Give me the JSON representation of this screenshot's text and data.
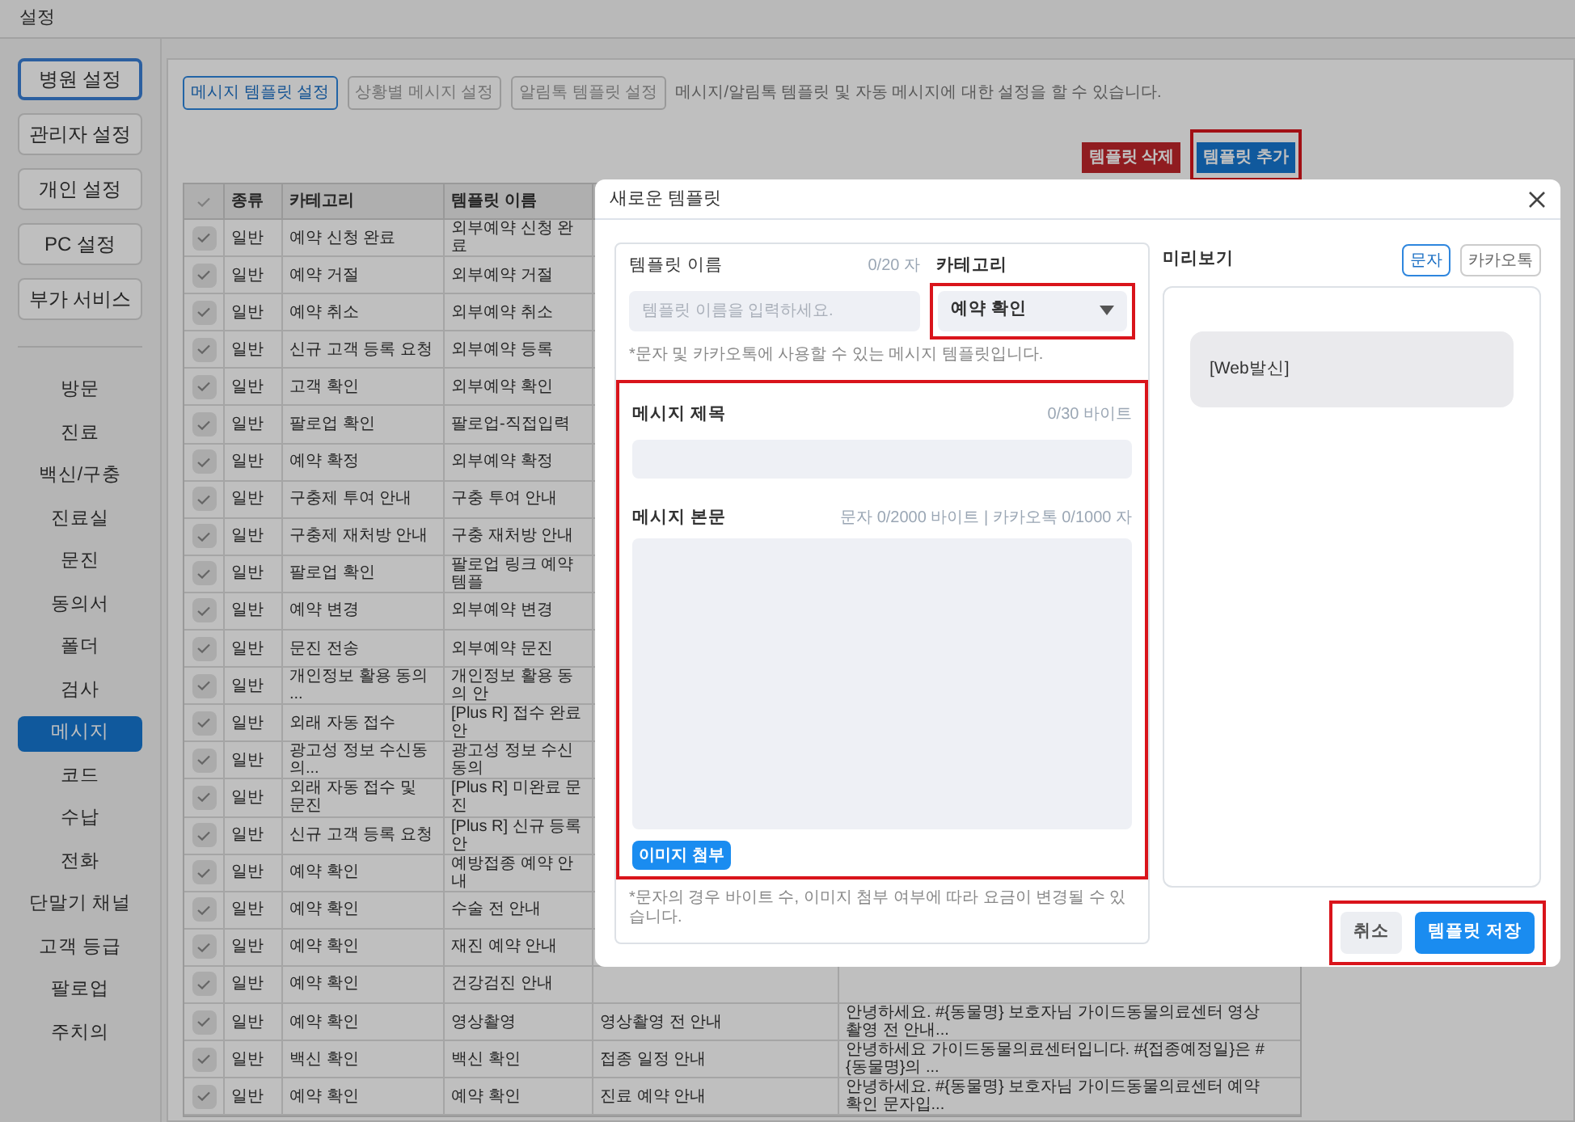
{
  "window": {
    "title": "설정"
  },
  "settings_menu": [
    {
      "label": "병원 설정",
      "selected": true
    },
    {
      "label": "관리자 설정",
      "selected": false
    },
    {
      "label": "개인 설정",
      "selected": false
    },
    {
      "label": "PC 설정",
      "selected": false
    },
    {
      "label": "부가 서비스",
      "selected": false
    }
  ],
  "nav": [
    {
      "label": "방문",
      "selected": false
    },
    {
      "label": "진료",
      "selected": false
    },
    {
      "label": "백신/구충",
      "selected": false
    },
    {
      "label": "진료실",
      "selected": false
    },
    {
      "label": "문진",
      "selected": false
    },
    {
      "label": "동의서",
      "selected": false
    },
    {
      "label": "폴더",
      "selected": false
    },
    {
      "label": "검사",
      "selected": false
    },
    {
      "label": "메시지",
      "selected": true
    },
    {
      "label": "코드",
      "selected": false
    },
    {
      "label": "수납",
      "selected": false
    },
    {
      "label": "전화",
      "selected": false
    },
    {
      "label": "단말기 채널",
      "selected": false
    },
    {
      "label": "고객 등급",
      "selected": false
    },
    {
      "label": "팔로업",
      "selected": false
    },
    {
      "label": "주치의",
      "selected": false
    }
  ],
  "tabs": [
    {
      "label": "메시지 템플릿 설정",
      "selected": true
    },
    {
      "label": "상황별 메시지 설정",
      "selected": false
    },
    {
      "label": "알림톡 템플릿 설정",
      "selected": false
    }
  ],
  "description": "메시지/알림톡 템플릿 및 자동 메시지에 대한 설정을 할 수 있습니다.",
  "actions": [
    {
      "label": "템플릿 삭제",
      "kind": "danger",
      "highlighted": false
    },
    {
      "label": "템플릿 추가",
      "kind": "primary",
      "highlighted": true
    }
  ],
  "table": {
    "columns": [
      "종류",
      "카테고리",
      "템플릿 이름"
    ],
    "rows": [
      {
        "checked": true,
        "type": "일반",
        "category": "예약 신청 완료",
        "name": "외부예약 신청 완료"
      },
      {
        "checked": true,
        "type": "일반",
        "category": "예약 거절",
        "name": "외부예약 거절"
      },
      {
        "checked": true,
        "type": "일반",
        "category": "예약 취소",
        "name": "외부예약 취소"
      },
      {
        "checked": true,
        "type": "일반",
        "category": "신규 고객 등록 요청",
        "name": "외부예약 등록"
      },
      {
        "checked": true,
        "type": "일반",
        "category": "고객 확인",
        "name": "외부예약 확인"
      },
      {
        "checked": true,
        "type": "일반",
        "category": "팔로업 확인",
        "name": "팔로업-직접입력"
      },
      {
        "checked": true,
        "type": "일반",
        "category": "예약 확정",
        "name": "외부예약 확정"
      },
      {
        "checked": true,
        "type": "일반",
        "category": "구충제 투여 안내",
        "name": "구충 투여 안내"
      },
      {
        "checked": true,
        "type": "일반",
        "category": "구충제 재처방 안내",
        "name": "구충 재처방 안내"
      },
      {
        "checked": true,
        "type": "일반",
        "category": "팔로업 확인",
        "name": "팔로업 링크 예약 템플"
      },
      {
        "checked": true,
        "type": "일반",
        "category": "예약 변경",
        "name": "외부예약 변경"
      },
      {
        "checked": true,
        "type": "일반",
        "category": "문진 전송",
        "name": "외부예약 문진"
      },
      {
        "checked": true,
        "type": "일반",
        "category": "개인정보 활용 동의 ...",
        "name": "개인정보 활용 동의 안"
      },
      {
        "checked": true,
        "type": "일반",
        "category": "외래 자동 접수",
        "name": "[Plus R] 접수 완료 안"
      },
      {
        "checked": true,
        "type": "일반",
        "category": "광고성 정보 수신동의...",
        "name": "광고성 정보 수신동의"
      },
      {
        "checked": true,
        "type": "일반",
        "category": "외래 자동 접수 및 문진",
        "name": "[Plus R] 미완료 문진"
      },
      {
        "checked": true,
        "type": "일반",
        "category": "신규 고객 등록 요청",
        "name": "[Plus R] 신규 등록 안"
      },
      {
        "checked": true,
        "type": "일반",
        "category": "예약 확인",
        "name": "예방접종 예약 안내"
      },
      {
        "checked": true,
        "type": "일반",
        "category": "예약 확인",
        "name": "수술 전 안내"
      },
      {
        "checked": true,
        "type": "일반",
        "category": "예약 확인",
        "name": "재진 예약 안내"
      },
      {
        "checked": true,
        "type": "일반",
        "category": "예약 확인",
        "name": "건강검진 안내"
      },
      {
        "checked": true,
        "type": "일반",
        "category": "예약 확인",
        "name": "영상촬영",
        "column_4": "영상촬영 전 안내",
        "column_5": "안녕하세요. #{동물명} 보호자님 가이드동물의료센터 영상촬영 전 안내..."
      },
      {
        "checked": true,
        "type": "일반",
        "category": "백신 확인",
        "name": "백신 확인",
        "column_4": "접종 일정 안내",
        "column_5": "안녕하세요 가이드동물의료센터입니다. #{접종예정일}은 #{동물명}의 ..."
      },
      {
        "checked": true,
        "type": "일반",
        "category": "예약 확인",
        "name": "예약 확인",
        "column_4": "진료 예약 안내",
        "column_5": "안녕하세요. #{동물명} 보호자님 가이드동물의료센터 예약확인 문자입..."
      }
    ]
  },
  "modal": {
    "title": "새로운 템플릿",
    "name_field": {
      "label": "템플릿 이름",
      "counter": "0/20 자",
      "placeholder": "템플릿 이름을 입력하세요."
    },
    "category_field": {
      "label": "카테고리",
      "value": "예약 확인",
      "highlighted": true
    },
    "name_hint": "*문자 및 카카오톡에 사용할 수 있는 메시지 템플릿입니다.",
    "message_section": {
      "highlighted": true,
      "subject_label": "메시지 제목",
      "subject_counter": "0/30 바이트",
      "body_label": "메시지 본문",
      "body_counter": "문자 0/2000 바이트 | 카카오톡 0/1000 자",
      "attach_button": "이미지 첨부"
    },
    "footnote": "*문자의 경우 바이트 수, 이미지 첨부 여부에 따라 요금이 변경될 수 있습니다.",
    "preview": {
      "label": "미리보기",
      "tabs": [
        {
          "label": "문자",
          "selected": true
        },
        {
          "label": "카카오톡",
          "selected": false
        }
      ],
      "bubble": "[Web발신]"
    },
    "footer": {
      "highlighted": true,
      "buttons": [
        {
          "label": "취소",
          "kind": "secondary"
        },
        {
          "label": "템플릿 저장",
          "kind": "primary"
        }
      ]
    }
  }
}
